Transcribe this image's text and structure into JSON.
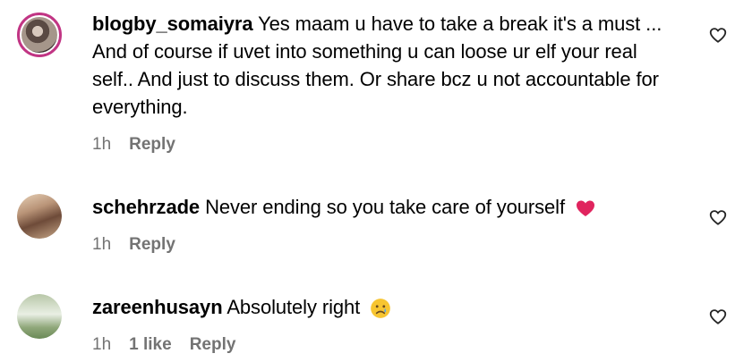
{
  "comments": [
    {
      "username": "blogby_somaiyra",
      "text": "Yes maam u have to take a break it's a must ... And of course if uvet into something u can loose ur elf your real self.. And just to discuss them. Or share bcz u not accountable for everything.",
      "time": "1h",
      "likes": "",
      "reply_label": "Reply",
      "emoji": ""
    },
    {
      "username": "schehrzade",
      "text": "Never ending so you take care of yourself",
      "time": "1h",
      "likes": "",
      "reply_label": "Reply",
      "emoji": "red-heart"
    },
    {
      "username": "zareenhusayn",
      "text": "Absolutely right",
      "time": "1h",
      "likes": "1 like",
      "reply_label": "Reply",
      "emoji": "crying-face"
    }
  ],
  "colors": {
    "meta_gray": "#737373",
    "story_ring": "#c13584",
    "heart_red": "#e0245e"
  }
}
